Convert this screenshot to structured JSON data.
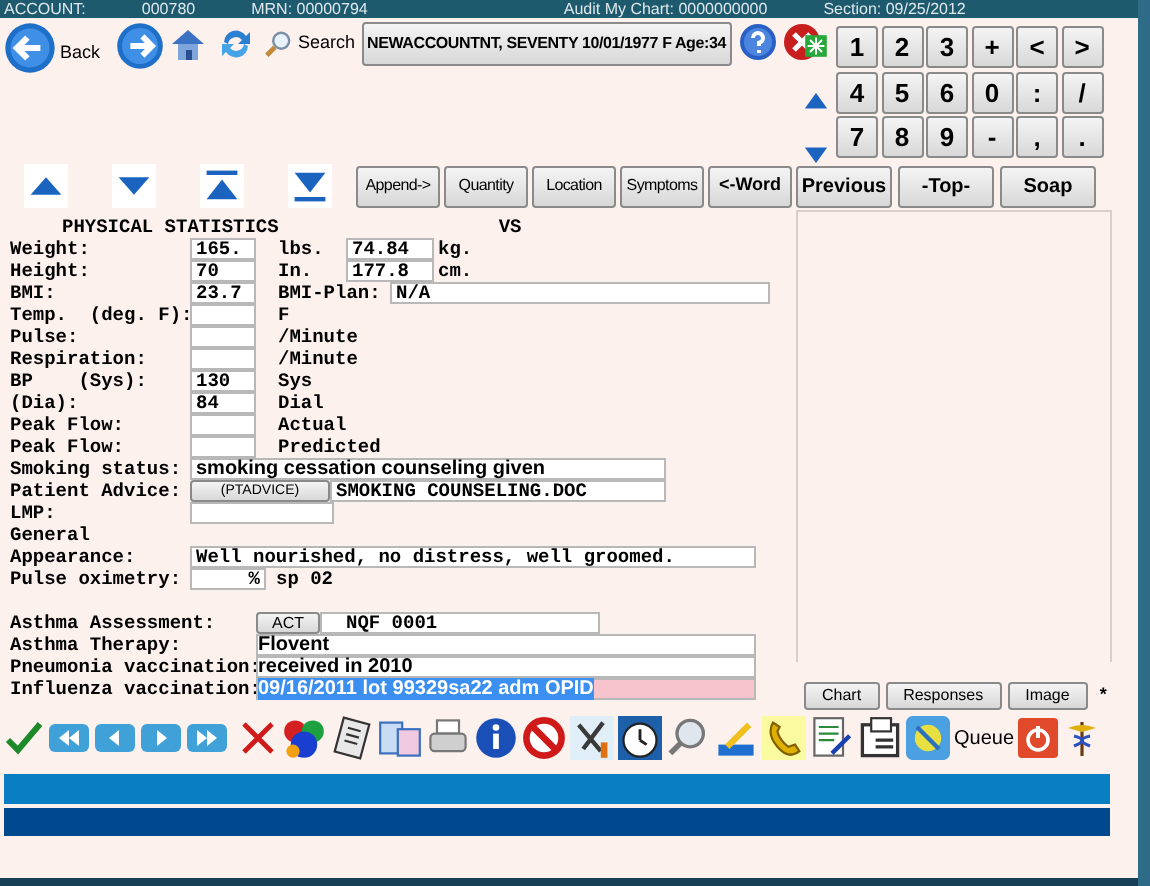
{
  "header": {
    "account": "ACCOUNT:",
    "account_no": "000780",
    "mrn": "MRN: 00000794",
    "audit": "Audit My Chart: 0000000000",
    "section": "Section: 09/25/2012"
  },
  "toolbar": {
    "back": "Back",
    "search": "Search",
    "patient": "NEWACCOUNTNT, SEVENTY 10/01/1977 F Age:34"
  },
  "keypad": [
    "1",
    "2",
    "3",
    "+",
    "<",
    ">",
    "4",
    "5",
    "6",
    "0",
    ":",
    "/",
    "7",
    "8",
    "9",
    "-",
    ",",
    "."
  ],
  "edit_buttons": [
    {
      "label": "Append->",
      "bold": false
    },
    {
      "label": "Quantity",
      "bold": false
    },
    {
      "label": "Location",
      "bold": false
    },
    {
      "label": "Symptoms",
      "bold": false
    },
    {
      "label": "<-Word",
      "bold": true
    }
  ],
  "nav_buttons": [
    "Previous",
    "-Top-",
    "Soap"
  ],
  "form": {
    "title": "PHYSICAL STATISTICS",
    "section": "VS",
    "rows": [
      {
        "kind": "measure",
        "label": "Weight:",
        "value": "165.",
        "unit": "lbs.",
        "value2": "74.84",
        "unit2": "kg."
      },
      {
        "kind": "measure",
        "label": "Height:",
        "value": "70",
        "unit": "In.",
        "value2": "177.8",
        "unit2": "cm."
      },
      {
        "kind": "plan",
        "label": "BMI:",
        "value": "23.7",
        "unit": "BMI-Plan:",
        "value2": "N/A"
      },
      {
        "kind": "simple",
        "label": "Temp.  (deg. F):",
        "unit": "F"
      },
      {
        "kind": "simple",
        "label": "Pulse:",
        "unit": "/Minute"
      },
      {
        "kind": "simple",
        "label": "Respiration:",
        "unit": "/Minute"
      },
      {
        "kind": "simple",
        "label": "BP    (Sys):",
        "value": "130",
        "unit": "Sys"
      },
      {
        "kind": "simple",
        "label": "(Dia):",
        "value": "84",
        "unit": "Dial"
      },
      {
        "kind": "simple",
        "label": "Peak Flow:",
        "unit": "Actual"
      },
      {
        "kind": "simple",
        "label": "Peak Flow:",
        "unit": "Predicted"
      },
      {
        "kind": "wide",
        "label": "Smoking status:",
        "value": "smoking cessation counseling given"
      },
      {
        "kind": "button",
        "label": "Patient Advice:",
        "button": "(PTADVICE)",
        "value": "SMOKING COUNSELING.DOC"
      },
      {
        "kind": "blank",
        "label": "LMP:"
      },
      {
        "kind": "heading",
        "label": "General"
      },
      {
        "kind": "long",
        "label": "Appearance:",
        "value": "Well nourished, no distress, well groomed."
      },
      {
        "kind": "percent",
        "label": "Pulse oximetry:",
        "value": "%",
        "unit": "sp 02"
      }
    ],
    "therapy_rows": [
      {
        "kind": "button",
        "label": "Asthma Assessment:",
        "button": "ACT",
        "value": "NQF 0001"
      },
      {
        "kind": "text",
        "label": "Asthma Therapy:",
        "value": "Flovent",
        "selected": false
      },
      {
        "kind": "text",
        "label": "Pneumonia vaccination:",
        "value": "received in 2010",
        "selected": false
      },
      {
        "kind": "text",
        "label": "Influenza vaccination:",
        "value": "09/16/2011 lot 99329sa22 adm OPID",
        "selected": true
      }
    ]
  },
  "side_buttons": [
    "Chart",
    "Responses",
    "Image"
  ],
  "side_mark": "*",
  "bottom_toolbar": {
    "queue": "Queue"
  }
}
